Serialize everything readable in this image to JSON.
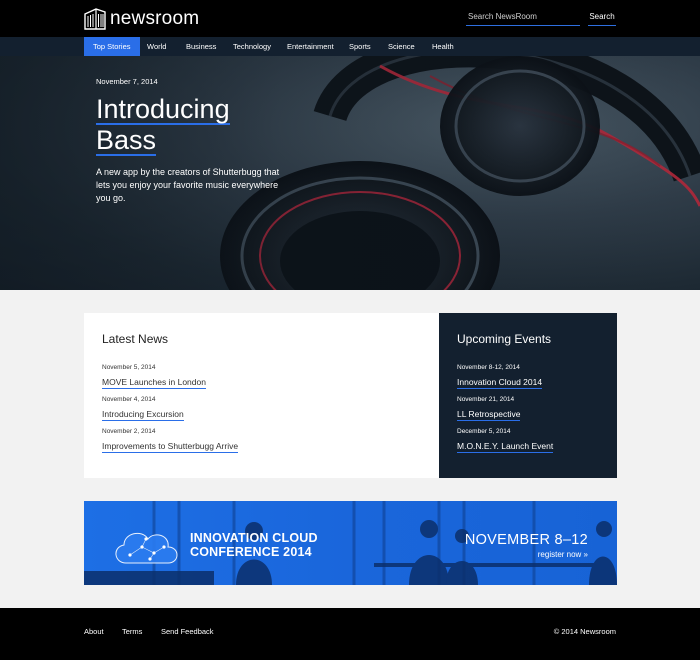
{
  "app": {
    "logo_text": "newsroom",
    "accent_color": "#2a6ee8",
    "dark_color": "#13202f",
    "logo_icon": "building-icon"
  },
  "search": {
    "placeholder": "Search NewsRoom",
    "value": "",
    "button_label": "Search"
  },
  "nav": {
    "items": [
      {
        "label": "Top Stories",
        "active": true
      },
      {
        "label": "World",
        "active": false
      },
      {
        "label": "Business",
        "active": false
      },
      {
        "label": "Technology",
        "active": false
      },
      {
        "label": "Entertainment",
        "active": false
      },
      {
        "label": "Sports",
        "active": false
      },
      {
        "label": "Science",
        "active": false
      },
      {
        "label": "Health",
        "active": false
      }
    ]
  },
  "hero": {
    "date": "November 7, 2014",
    "title_line1": "Introducing",
    "title_line2": "Bass",
    "description": "A new app by the creators of Shutterbugg that lets you enjoy your favorite music everywhere you go."
  },
  "latest_news": {
    "title": "Latest News",
    "items": [
      {
        "date": "November 5, 2014",
        "title": "MOVE Launches in London"
      },
      {
        "date": "November 4, 2014",
        "title": "Introducing Excursion"
      },
      {
        "date": "November 2, 2014",
        "title": "Improvements to Shutterbugg Arrive"
      }
    ]
  },
  "upcoming_events": {
    "title": "Upcoming Events",
    "items": [
      {
        "date": "November 8-12, 2014",
        "title": "Innovation Cloud 2014"
      },
      {
        "date": "November 21, 2014",
        "title": "LL Retrospective"
      },
      {
        "date": "December 5, 2014",
        "title": "M.O.N.E.Y. Launch Event"
      }
    ]
  },
  "banner": {
    "title_line1": "INNOVATION CLOUD",
    "title_line2": "CONFERENCE 2014",
    "date": "NOVEMBER 8–12",
    "cta": "register now »",
    "icon": "cloud-icon"
  },
  "footer": {
    "links": [
      "About",
      "Terms",
      "Send Feedback"
    ],
    "copyright": "© 2014 Newsroom"
  }
}
